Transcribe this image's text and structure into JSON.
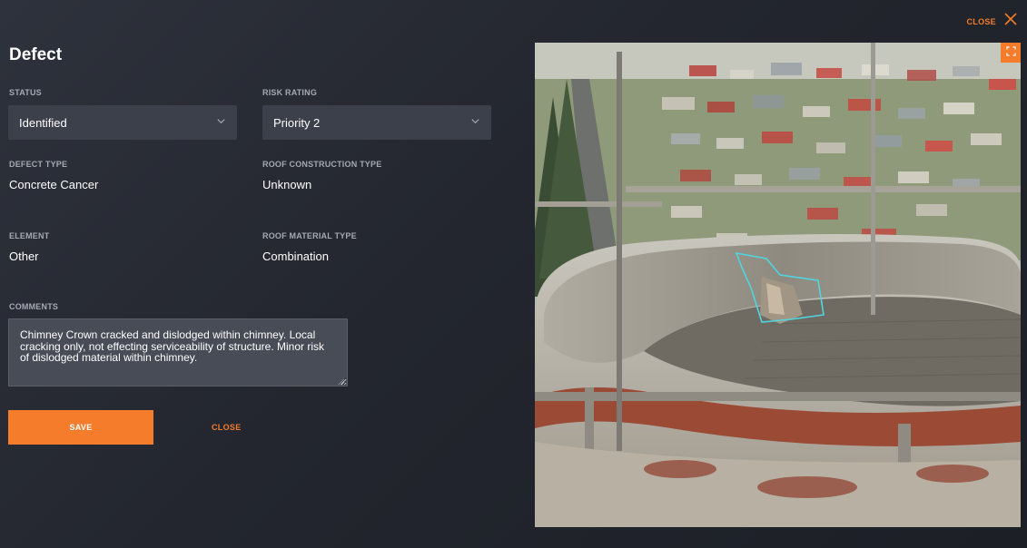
{
  "header": {
    "close_label": "CLOSE",
    "close_icon": "close-x-icon"
  },
  "form": {
    "title": "Defect",
    "status": {
      "label": "STATUS",
      "value": "Identified"
    },
    "risk_rating": {
      "label": "RISK RATING",
      "value": "Priority 2"
    },
    "defect_type": {
      "label": "DEFECT TYPE",
      "value": "Concrete Cancer"
    },
    "roof_construction_type": {
      "label": "ROOF CONSTRUCTION TYPE",
      "value": "Unknown"
    },
    "element": {
      "label": "ELEMENT",
      "value": "Other"
    },
    "roof_material_type": {
      "label": "ROOF MATERIAL TYPE",
      "value": "Combination"
    },
    "comments": {
      "label": "COMMENTS",
      "value": "Chimney Crown cracked and dislodged within chimney. Local cracking only, not effecting serviceability of structure. Minor risk of dislodged material within chimney."
    },
    "save_label": "SAVE",
    "close_label": "CLOSE"
  },
  "photo": {
    "fullscreen_icon": "expand-icon",
    "annotation_color": "#4fd6e0"
  },
  "colors": {
    "accent": "#f47c2a",
    "background": "#23262e",
    "field": "#3b404b"
  }
}
